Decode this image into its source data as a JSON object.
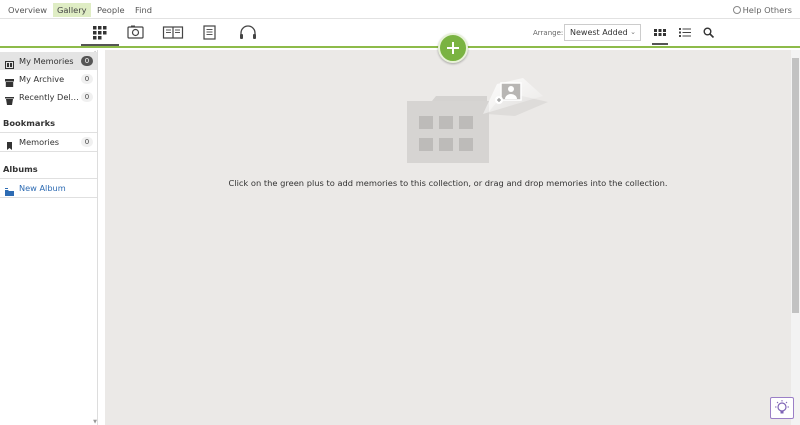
{
  "nav": {
    "tabs": [
      "Overview",
      "Gallery",
      "People",
      "Find"
    ],
    "active_tab": "Gallery",
    "help_label": "Help Others"
  },
  "toolbar": {
    "icons": [
      "grid-icon",
      "camera-icon",
      "book-icon",
      "document-icon",
      "headphones-icon"
    ],
    "arrange_label": "Arrange:",
    "arrange_value": "Newest Added",
    "view_icons": [
      "grid-view-icon",
      "list-view-icon",
      "search-icon"
    ],
    "add_icon": "plus-icon"
  },
  "sidebar": {
    "items": [
      {
        "label": "My Memories",
        "count": "0",
        "icon": "memories-icon"
      },
      {
        "label": "My Archive",
        "count": "0",
        "icon": "archive-icon"
      },
      {
        "label": "Recently Delet...",
        "count": "0",
        "icon": "trash-icon"
      }
    ],
    "bookmarks_heading": "Bookmarks",
    "bookmarks": [
      {
        "label": "Memories",
        "count": "0",
        "icon": "bookmark-icon"
      }
    ],
    "albums_heading": "Albums",
    "new_album_label": "New Album"
  },
  "main": {
    "empty_message": "Click on the green plus to add memories to this collection, or drag and drop memories into the collection."
  },
  "colors": {
    "accent_green": "#7ab342",
    "active_tab_bg": "#dfedc4",
    "link_blue": "#2d6bb3",
    "content_bg": "#ebe9e7"
  }
}
